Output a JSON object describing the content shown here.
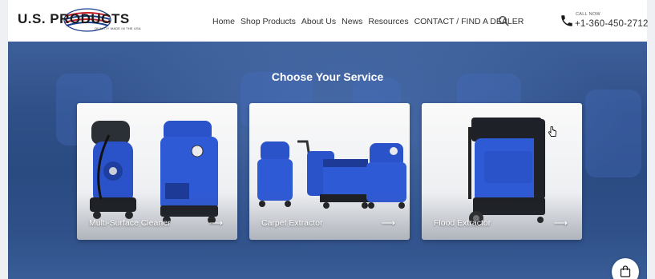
{
  "brand": {
    "name": "U.S. PRODUCTS",
    "tagline": "QUALITY MADE IN THE USA"
  },
  "nav": {
    "items": [
      "Home",
      "Shop Products",
      "About Us",
      "News",
      "Resources",
      "CONTACT / FIND A DEALER"
    ]
  },
  "contact": {
    "call_label": "CALL NOW",
    "phone": "+1-360-450-2712"
  },
  "hero": {
    "title": "Choose Your Service"
  },
  "cards": [
    {
      "label": "Multi-Surface Cleaner",
      "arrow": "⟶"
    },
    {
      "label": "Carpet Extractor",
      "arrow": "⟶"
    },
    {
      "label": "Flood Extractor",
      "arrow": "⟶"
    }
  ],
  "icons": {
    "search": "search-icon",
    "phone": "phone-icon",
    "cart": "shopping-bag-icon",
    "arrow": "arrow-right-icon"
  },
  "colors": {
    "brand_red": "#c8202f",
    "brand_blue": "#1b3d8f",
    "machine_blue": "#2a52c9",
    "hero_blue": "#2f4f88"
  }
}
